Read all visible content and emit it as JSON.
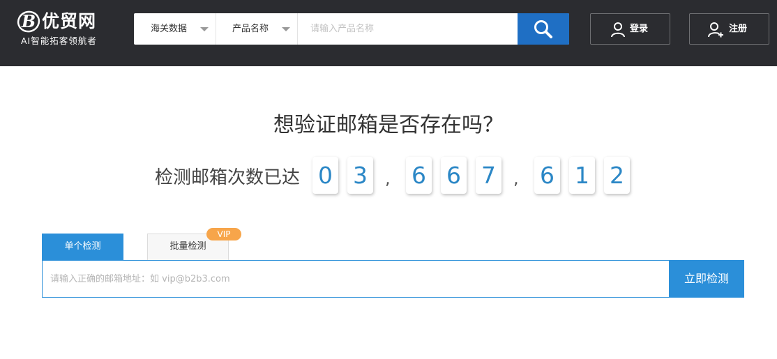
{
  "header": {
    "logo": {
      "name": "优贸网",
      "slogan": "AI智能拓客领航者",
      "mark_letter": "B"
    },
    "search": {
      "select_data_type": "海关数据",
      "select_field": "产品名称",
      "placeholder": "请输入产品名称"
    },
    "login_label": "登录",
    "register_label": "注册"
  },
  "main": {
    "title": "想验证邮箱是否存在吗？",
    "counter_label": "检测邮箱次数已达",
    "counter_digits": [
      "0",
      "3",
      "6",
      "6",
      "7",
      "6",
      "1",
      "2"
    ],
    "separators": [
      ",",
      ","
    ],
    "tabs": [
      {
        "label": "单个检测",
        "active": true
      },
      {
        "label": "批量检测",
        "active": false
      }
    ],
    "vip_badge": "VIP",
    "email_placeholder": "请输入正确的邮箱地址：如 vip@b2b3.com",
    "check_button": "立即检测"
  },
  "colors": {
    "header_bg": "#2b2c30",
    "accent_blue": "#2b8fd9",
    "search_button": "#1f6fc4",
    "digit_blue": "#2b87c6",
    "vip_orange": "#f7a54a"
  },
  "icons": [
    "logo-b-icon",
    "search-icon",
    "user-icon",
    "user-add-icon",
    "caret-down-icon"
  ]
}
